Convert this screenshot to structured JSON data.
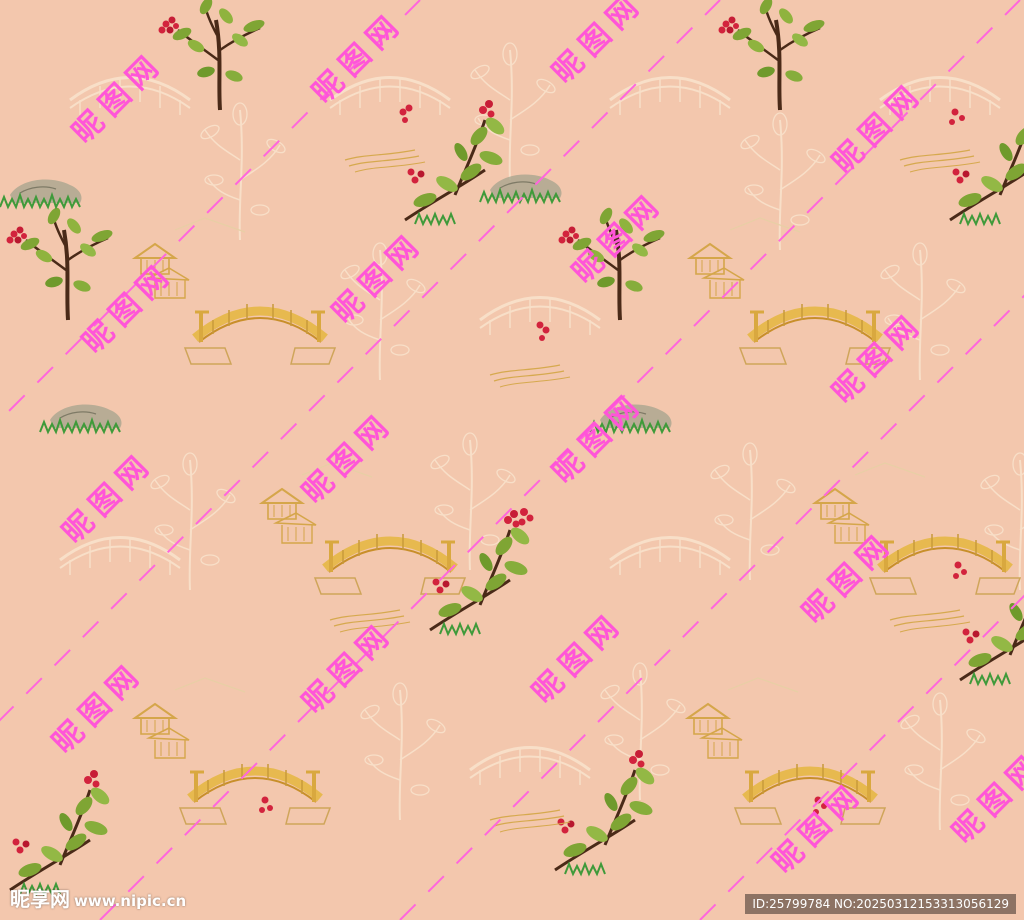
{
  "colors": {
    "background": "#f3c7ad",
    "watermark": "#ff55d8",
    "bridge_gold": "#e0b24a",
    "leaf_green": "#7fa534",
    "berry_red": "#d2233d",
    "trunk_brown": "#4a2a18",
    "faint_line": "#f7dcc4"
  },
  "watermark": {
    "text": "昵图网"
  },
  "footer": {
    "logo_text": "昵享网",
    "logo_url": "www.nipic.cn",
    "image_id": "ID:25799784 NO:20250312153313056129"
  },
  "motifs": {
    "icon_names": [
      "arched-bridge-icon",
      "pavilion-icon",
      "berry-tree-icon",
      "rock-grass-icon"
    ]
  }
}
